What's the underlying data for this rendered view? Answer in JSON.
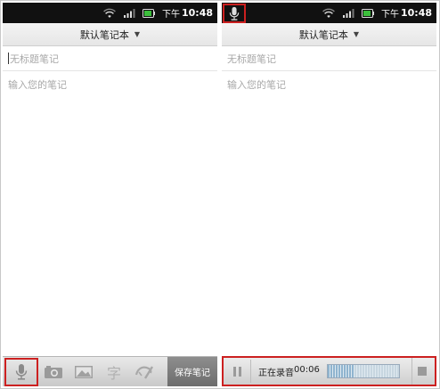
{
  "status": {
    "ampm": "下午",
    "time": "10:48"
  },
  "left": {
    "notebook": "默认笔记本",
    "title_placeholder": "无标题笔记",
    "body_placeholder": "输入您的笔记",
    "toolbar": {
      "icons": [
        "microphone-icon",
        "camera-icon",
        "image-icon",
        "text-icon",
        "handwriting-icon"
      ],
      "char_glyph": "字",
      "save_label": "保存笔记"
    }
  },
  "right": {
    "notebook": "默认笔记本",
    "title_placeholder": "无标题笔记",
    "body_placeholder": "输入您的笔记",
    "recording": {
      "label": "正在录音",
      "elapsed": "00:06",
      "level": 0.38
    }
  },
  "colors": {
    "highlight": "#cc2020",
    "statusbar": "#111111",
    "meter": "#8fb4cf"
  }
}
